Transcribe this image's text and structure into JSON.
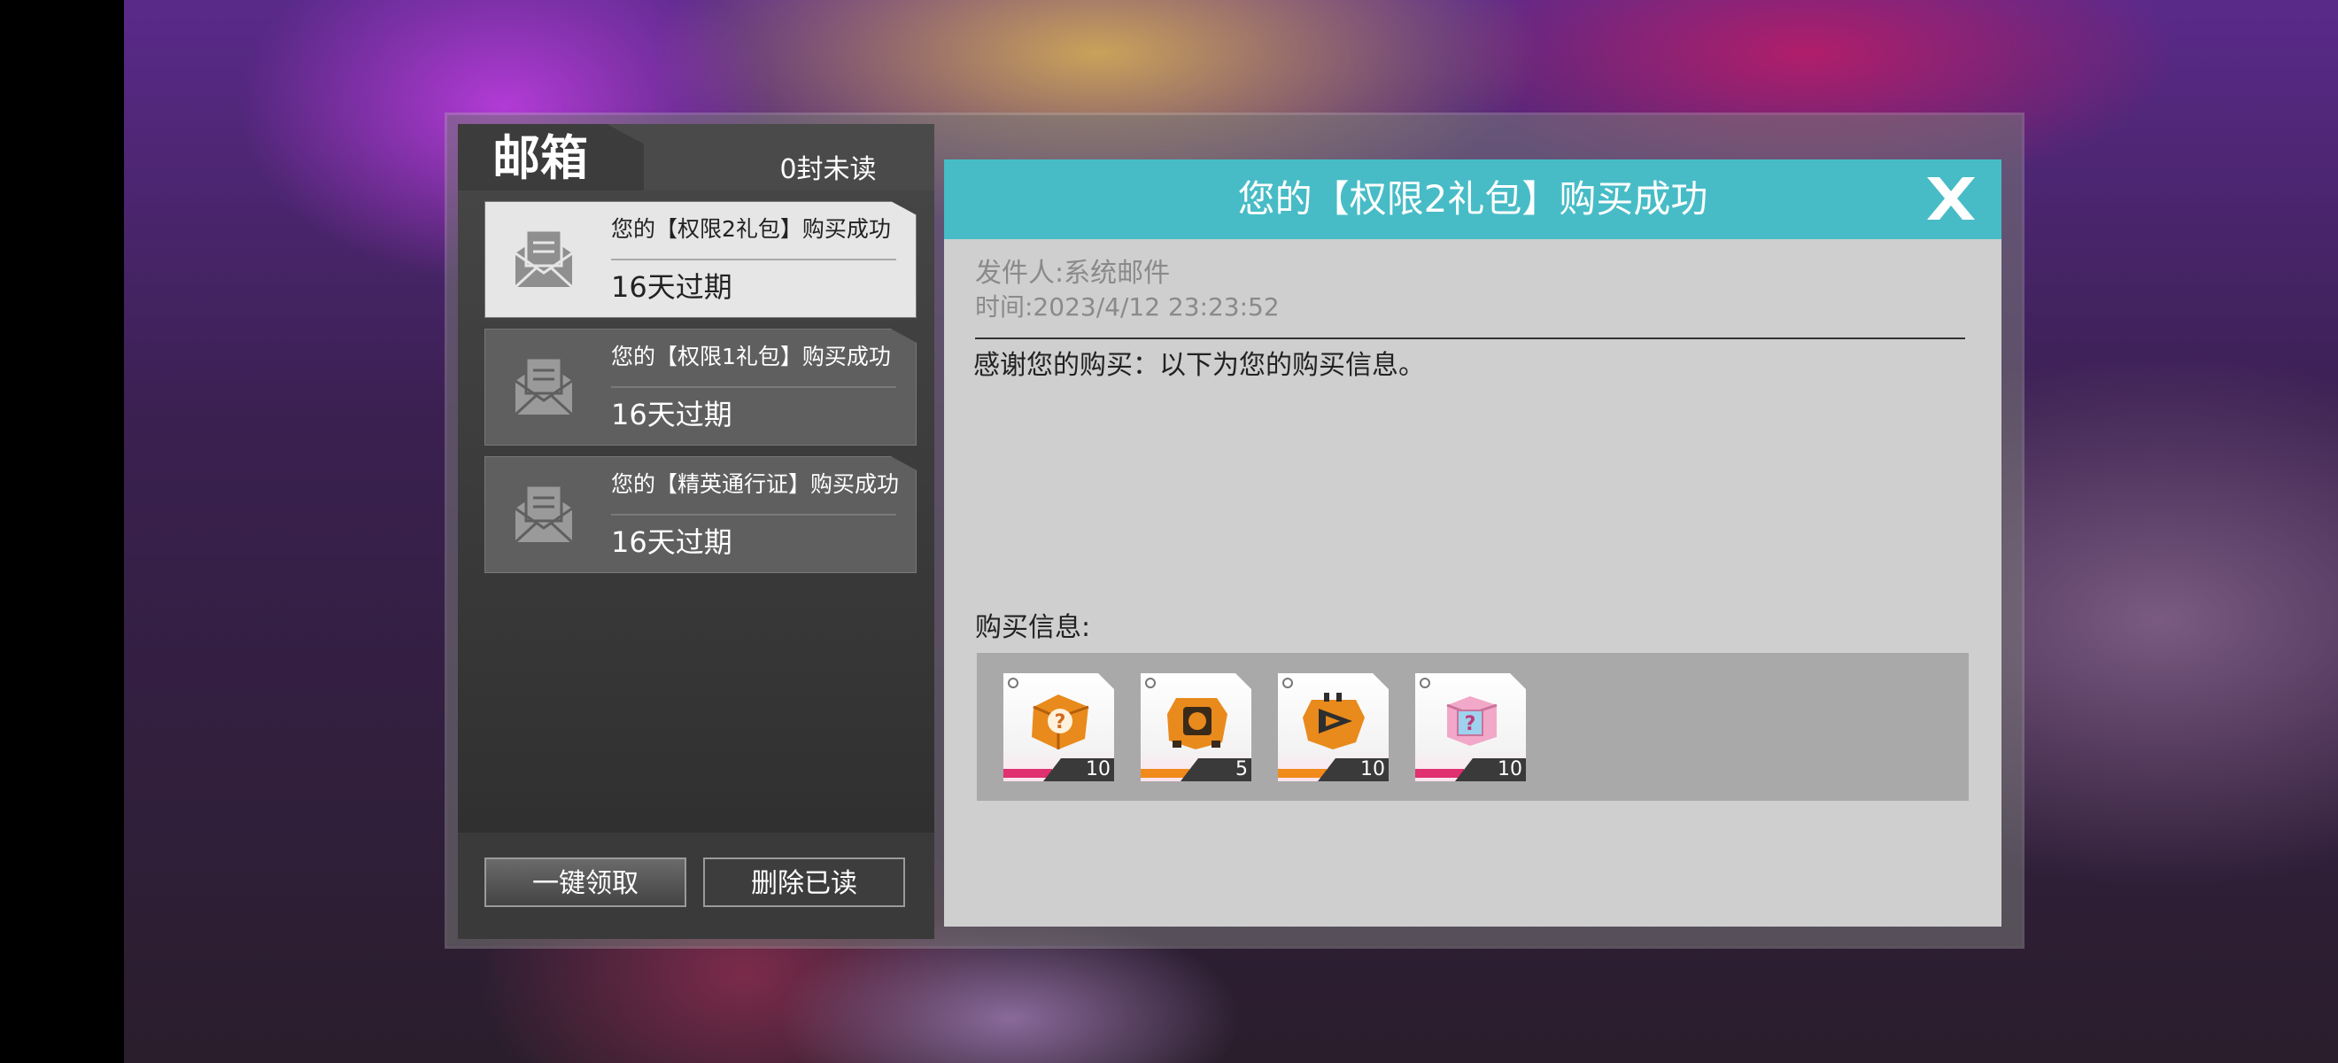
{
  "mailbox": {
    "title": "邮箱",
    "unread": "0封未读"
  },
  "mails": [
    {
      "subject": "您的【权限2礼包】购买成功",
      "expiry": "16天过期",
      "selected": true
    },
    {
      "subject": "您的【权限1礼包】购买成功",
      "expiry": "16天过期",
      "selected": false
    },
    {
      "subject": "您的【精英通行证】购买成功",
      "expiry": "16天过期",
      "selected": false
    }
  ],
  "buttons": {
    "claim_all": "一键领取",
    "delete_read": "删除已读"
  },
  "detail": {
    "title": "您的【权限2礼包】购买成功",
    "sender": "发件人:系统邮件",
    "time": "时间:2023/4/12 23:23:52",
    "body": "感谢您的购买：以下为您的购买信息。",
    "purchase_label": "购买信息:",
    "items": [
      {
        "icon": "orange-mystery-box-icon",
        "quantity": "10",
        "accent": "#e0306f"
      },
      {
        "icon": "orange-emblem-chip-icon",
        "quantity": "5",
        "accent": "#f08a1a"
      },
      {
        "icon": "orange-triangle-chip-icon",
        "quantity": "10",
        "accent": "#f08a1a"
      },
      {
        "icon": "pink-mystery-box-icon",
        "quantity": "10",
        "accent": "#e0306f"
      }
    ]
  },
  "colors": {
    "header_teal": "#47bcc6",
    "panel_gray": "#cfcfcf",
    "left_panel": "#3a3a3a"
  }
}
